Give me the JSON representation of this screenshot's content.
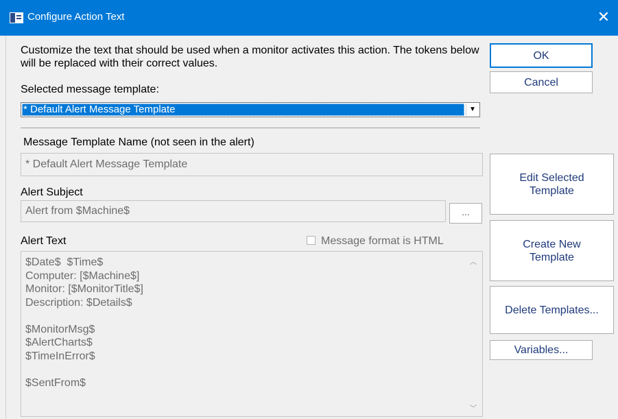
{
  "window": {
    "title": "Configure Action Text",
    "close_glyph": "✕",
    "icon": "window-icon"
  },
  "intro": "Customize the text that should be used when a monitor activates this action. The tokens below will be replaced with their correct values.",
  "template_select": {
    "label": "Selected message template:",
    "value": "* Default Alert Message Template",
    "arrow": "▼"
  },
  "template_name": {
    "label": "Message Template Name (not seen in the alert)",
    "value": "* Default Alert Message Template"
  },
  "subject": {
    "label": "Alert Subject",
    "value": "Alert from $Machine$",
    "browse_label": "..."
  },
  "alert_text": {
    "label": "Alert Text",
    "html_checkbox_label": "Message format is HTML",
    "html_checked": false,
    "lines": [
      "$Date$  $Time$",
      "Computer: [$Machine$]",
      "Monitor: [$MonitorTitle$]",
      "Description: $Details$",
      "",
      "$MonitorMsg$",
      "$AlertCharts$",
      "$TimeInError$",
      "",
      "$SentFrom$"
    ]
  },
  "buttons": {
    "ok": "OK",
    "cancel": "Cancel",
    "edit": "Edit Selected Template",
    "create": "Create New Template",
    "delete": "Delete Templates...",
    "variables": "Variables..."
  },
  "colors": {
    "title_bar": "#0078d7",
    "selection": "#0078d7",
    "button_text_accent": "#1f3a7a"
  }
}
